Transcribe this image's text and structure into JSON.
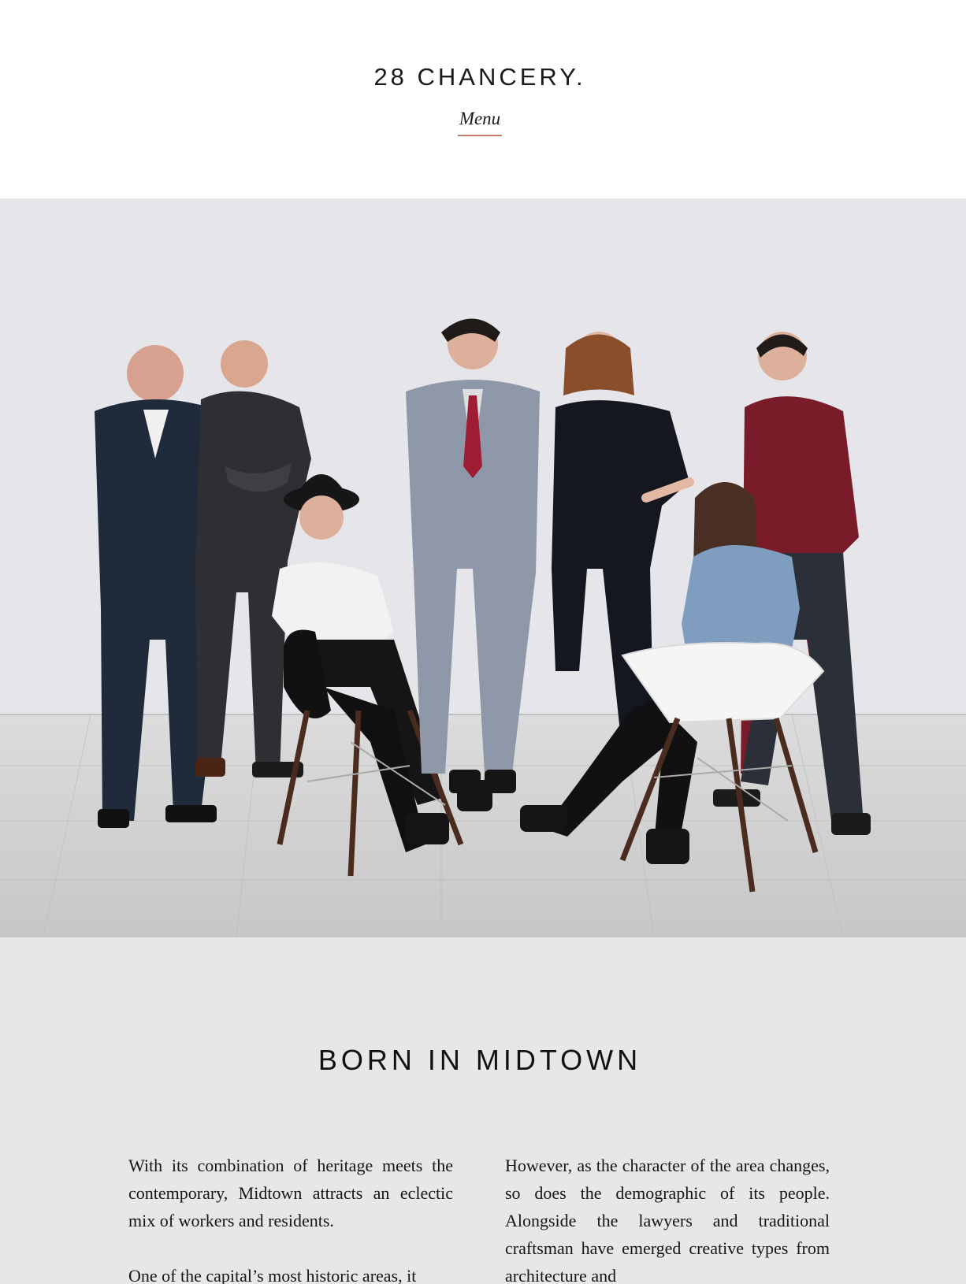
{
  "header": {
    "logo": "28 CHANCERY.",
    "menu_label": "Menu"
  },
  "hero": {
    "image": "group portrait of seven people, five standing and two seated on white chairs, in front of a white wall"
  },
  "section": {
    "title": "BORN IN MIDTOWN",
    "left_column": [
      "With its combination of heritage meets the contemporary, Midtown attracts an eclectic mix of workers and residents.",
      "One of the capital’s most historic areas, it"
    ],
    "right_column": [
      "However, as the character of the area changes, so does the demographic of its people. Alongside the lawyers and traditional craftsman have emerged creative types from architecture and"
    ]
  },
  "colors": {
    "background": "#ffffff",
    "content_background": "#e7e7ea",
    "menu_underline": "#c77b6d"
  }
}
